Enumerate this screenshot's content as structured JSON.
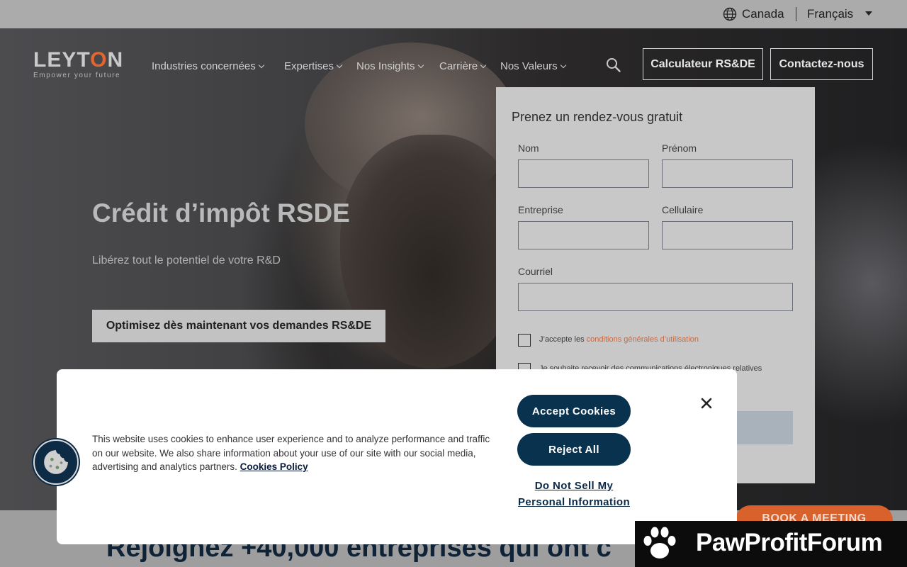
{
  "topbar": {
    "country": "Canada",
    "language": "Français"
  },
  "logo": {
    "name_pre": "LEYT",
    "name_o": "O",
    "name_post": "N",
    "tagline": "Empower your future"
  },
  "nav": {
    "items": [
      {
        "label": "Industries concernées"
      },
      {
        "label": "Expertises"
      },
      {
        "label": "Nos Insights"
      },
      {
        "label": "Carrière"
      },
      {
        "label": "Nos Valeurs"
      }
    ]
  },
  "header_buttons": {
    "calculator": "Calculateur RS&DE",
    "contact": "Contactez-nous"
  },
  "hero": {
    "title": "Crédit d’impôt RSDE",
    "subtitle": "Libérez tout le potentiel de votre R&D",
    "cta": "Optimisez dès maintenant vos demandes RS&DE"
  },
  "form": {
    "title": "Prenez un rendez-vous gratuit",
    "fields": {
      "nom": "Nom",
      "prenom": "Prénom",
      "entreprise": "Entreprise",
      "cellulaire": "Cellulaire",
      "courriel": "Courriel"
    },
    "terms_prefix": "J’accepte les ",
    "terms_link": "conditions générales d’utilisation",
    "comms_text": "Je souhaite recevoir des communications électroniques relatives"
  },
  "cookie": {
    "text": "This website uses cookies to enhance user experience and to analyze performance and traffic on our website. We also share information about your use of our site with our social media, advertising and analytics partners. ",
    "policy_link": "Cookies Policy",
    "accept": "Accept Cookies",
    "reject": "Reject All",
    "do_not_sell_line1": "Do Not Sell My",
    "do_not_sell_line2": "Personal Information"
  },
  "bottom": {
    "heading": "Rejoignez +40,000 entreprises qui ont c"
  },
  "book_meeting": "BOOK A MEETING",
  "watermark": {
    "text": "PawProfitForum"
  },
  "colors": {
    "brand_orange": "#e1662f",
    "cookie_button": "#09324f",
    "form_bg": "#c8c8c8"
  },
  "icons": {
    "globe": "globe-icon",
    "caret": "caret-down-icon",
    "search": "search-icon",
    "close": "close-icon",
    "cookie": "cookie-icon",
    "paw": "paw-icon",
    "chevron": "chevron-down-icon"
  }
}
